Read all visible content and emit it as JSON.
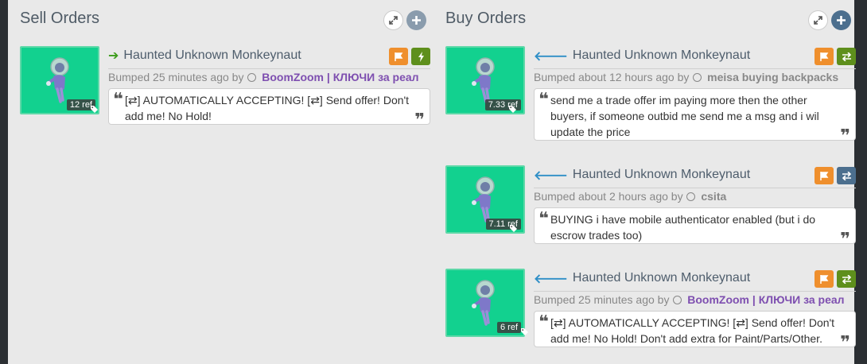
{
  "sell_panel": {
    "title": "Sell Orders",
    "listings": [
      {
        "item_name": "Haunted Unknown Monkeynaut",
        "price": "12 ref",
        "bump_text": "Bumped 25 minutes ago by",
        "user": "BoomZoom | КЛЮЧИ за реал",
        "comment": "[⇄] AUTOMATICALLY ACCEPTING! [⇄] Send offer! Don't add me! No Hold!",
        "badges": [
          "flag-icon",
          "bolt-icon"
        ]
      }
    ]
  },
  "buy_panel": {
    "title": "Buy Orders",
    "listings": [
      {
        "item_name": "Haunted Unknown Monkeynaut",
        "price": "7.33 ref",
        "bump_text": "Bumped about 12 hours ago by",
        "user": "meisa buying backpacks",
        "comment": "send me a trade offer im paying more then the other buyers, if someone outbid me send me a msg and i wil update the price",
        "badges": [
          "flag-icon",
          "trade-icon"
        ]
      },
      {
        "item_name": "Haunted Unknown Monkeynaut",
        "price": "7.11 ref",
        "bump_text": "Bumped about 2 hours ago by",
        "user": "csita",
        "comment": "BUYING i have mobile authenticator enabled (but i do escrow trades too)",
        "badges": [
          "flag-icon",
          "trade-icon"
        ]
      },
      {
        "item_name": "Haunted Unknown Monkeynaut",
        "price": "6 ref",
        "bump_text": "Bumped 25 minutes ago by",
        "user": "BoomZoom | КЛЮЧИ за реал",
        "comment": "[⇄] AUTOMATICALLY ACCEPTING! [⇄] Send offer! Don't add me! No Hold! Don't add extra for Paint/Parts/Other.",
        "badges": [
          "flag-icon",
          "trade-icon"
        ]
      }
    ]
  },
  "colors": {
    "item_bg": "#12d18f",
    "flag": "#ef8f2d",
    "green_badge": "#5e8f1c",
    "blue_badge": "#4c6f8e",
    "sell_arrow": "#3b9c1a",
    "buy_arrow": "#2f8fc7",
    "user_purple": "#7e4fb0"
  }
}
